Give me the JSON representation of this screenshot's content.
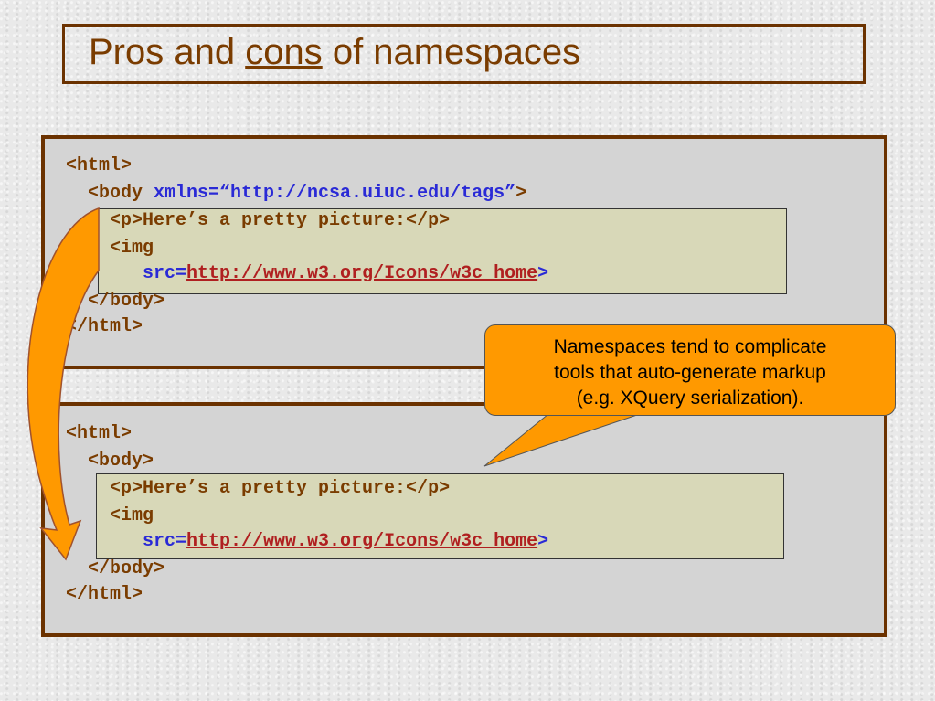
{
  "slide": {
    "title_parts": [
      "Pros and ",
      "cons",
      " of namespaces"
    ]
  },
  "code_before": {
    "lines": [
      "<html>",
      "  <body",
      " xmlns=“http://ncsa.uiuc.edu/tags”",
      ">",
      "    <p>Here’s a pretty picture:</p>",
      "    <img",
      "       src=",
      "http://www.w3.org/Icons/w3c_home",
      ">",
      "  </body>",
      "</html>"
    ]
  },
  "code_after": {
    "lines": [
      "<html>",
      "  <body>",
      "    <p>Here’s a pretty picture:</p>",
      "    <img",
      "       src=",
      "http://www.w3.org/Icons/w3c_home",
      ">",
      "  </body>",
      "</html>"
    ]
  },
  "callout": {
    "lines": [
      "Namespaces tend to complicate",
      "tools that auto-generate markup",
      "(e.g. XQuery serialization)."
    ]
  },
  "colors": {
    "title": "#7a3c00",
    "code_tag": "#7a3c00",
    "code_attr": "#2a2ad6",
    "link": "#b02020",
    "callout_fill": "#ff9900",
    "arrow_fill": "#ff9900",
    "box_border": "#6b3200"
  }
}
